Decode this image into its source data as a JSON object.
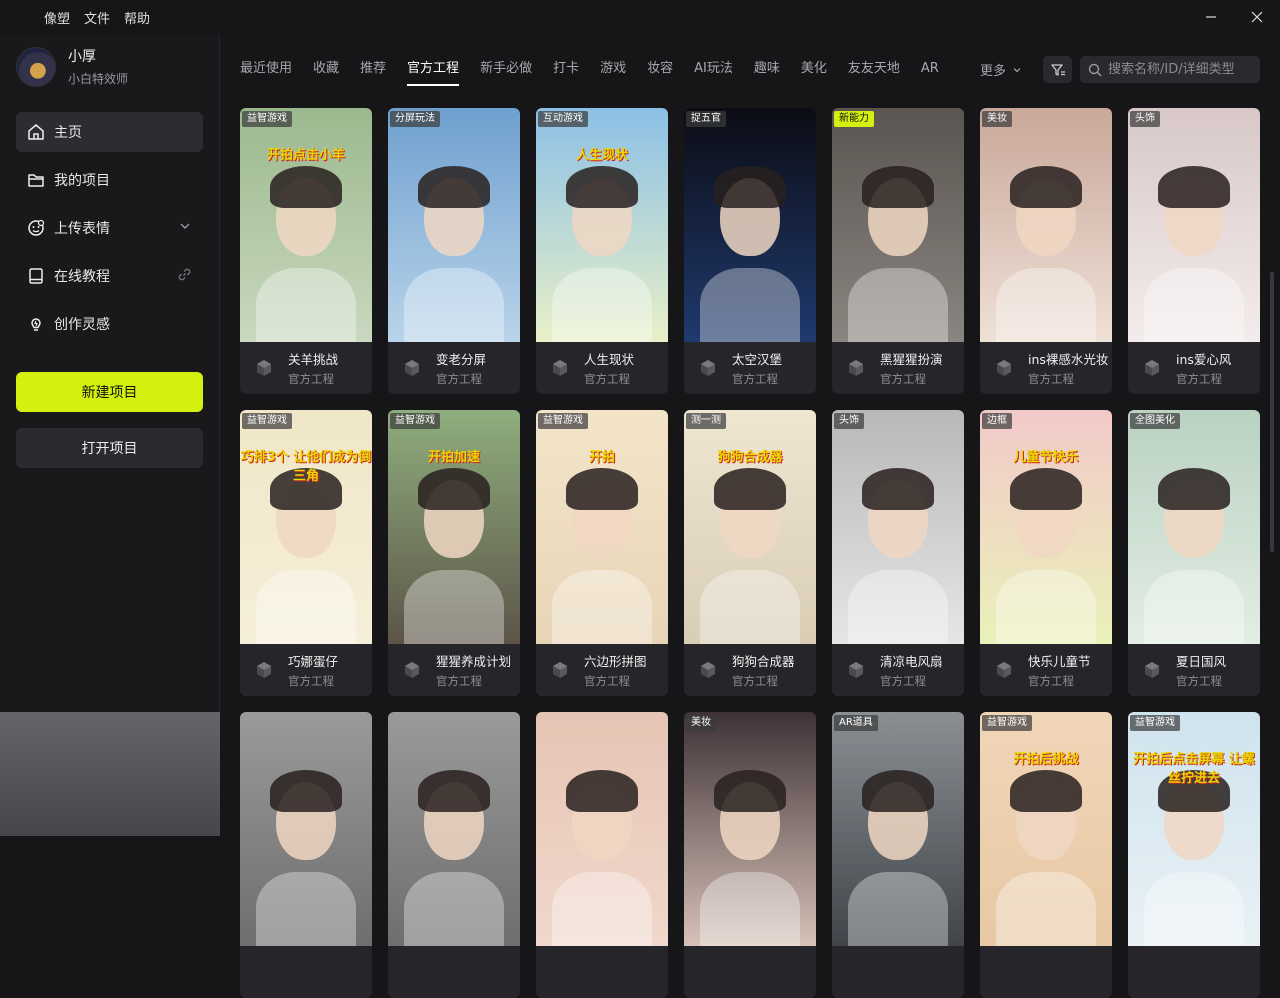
{
  "titlebar": {
    "menus": [
      "像塑",
      "文件",
      "帮助"
    ]
  },
  "user": {
    "name": "小厚",
    "role": "小白特效师"
  },
  "nav": [
    {
      "label": "主页",
      "icon": "home-icon",
      "active": true
    },
    {
      "label": "我的项目",
      "icon": "folder-icon",
      "active": false
    },
    {
      "label": "上传表情",
      "icon": "face-upload-icon",
      "active": false,
      "trail": "chevron-down-icon"
    },
    {
      "label": "在线教程",
      "icon": "book-icon",
      "active": false,
      "trail": "link-icon"
    },
    {
      "label": "创作灵感",
      "icon": "bulb-icon",
      "active": false
    }
  ],
  "buttons": {
    "new_project": "新建项目",
    "open_project": "打开项目"
  },
  "tabs": [
    "最近使用",
    "收藏",
    "推荐",
    "官方工程",
    "新手必做",
    "打卡",
    "游戏",
    "妆容",
    "AI玩法",
    "趣味",
    "美化",
    "友友天地",
    "AR"
  ],
  "active_tab": "官方工程",
  "more_label": "更多",
  "search": {
    "placeholder": "搜索名称/ID/详细类型"
  },
  "cards": [
    {
      "badge": "益智游戏",
      "title": "关羊挑战",
      "subtitle": "官方工程",
      "thumb_text": "开拍点击小羊",
      "bg": [
        "#9bb98e",
        "#c9d8bf"
      ]
    },
    {
      "badge": "分屏玩法",
      "title": "变老分屏",
      "subtitle": "官方工程",
      "thumb_text": "",
      "bg": [
        "#6fa0cf",
        "#b9d4ea"
      ]
    },
    {
      "badge": "互动游戏",
      "title": "人生现状",
      "subtitle": "官方工程",
      "thumb_text": "人生现状",
      "bg": [
        "#8cc0e6",
        "#e8f0c8"
      ]
    },
    {
      "badge": "捉五官",
      "title": "太空汉堡",
      "subtitle": "官方工程",
      "thumb_text": "",
      "bg": [
        "#0c0c14",
        "#1f3a6e"
      ]
    },
    {
      "badge": "新能力",
      "badge_yellow": true,
      "title": "黑猩猩扮演",
      "subtitle": "官方工程",
      "thumb_text": "",
      "bg": [
        "#5a5550",
        "#8a8580"
      ]
    },
    {
      "badge": "美妆",
      "title": "ins裸感水光妆",
      "subtitle": "官方工程",
      "thumb_text": "",
      "bg": [
        "#c9a89a",
        "#efe0d6"
      ]
    },
    {
      "badge": "头饰",
      "title": "ins爱心风",
      "subtitle": "官方工程",
      "thumb_text": "",
      "bg": [
        "#d8c8c8",
        "#f4ecec"
      ]
    },
    {
      "badge": "益智游戏",
      "title": "巧娜蛋仔",
      "subtitle": "官方工程",
      "thumb_text": "巧排3个 让他们成为倒三角",
      "bg": [
        "#f0e6c8",
        "#f6efd9"
      ]
    },
    {
      "badge": "益智游戏",
      "title": "猩猩养成计划",
      "subtitle": "官方工程",
      "thumb_text": "开拍加速",
      "bg": [
        "#8fae7e",
        "#5c5448"
      ]
    },
    {
      "badge": "益智游戏",
      "title": "六边形拼图",
      "subtitle": "官方工程",
      "thumb_text": "开拍",
      "bg": [
        "#f3e4c9",
        "#e8d5b8"
      ]
    },
    {
      "badge": "测一测",
      "title": "狗狗合成器",
      "subtitle": "官方工程",
      "thumb_text": "狗狗合成器",
      "bg": [
        "#efe6d2",
        "#d9cdb5"
      ]
    },
    {
      "badge": "头饰",
      "title": "清凉电风扇",
      "subtitle": "官方工程",
      "thumb_text": "",
      "bg": [
        "#b8b8b8",
        "#e6e6e6"
      ]
    },
    {
      "badge": "边框",
      "title": "快乐儿童节",
      "subtitle": "官方工程",
      "thumb_text": "儿童节快乐",
      "bg": [
        "#f2c9c9",
        "#eaf1b9"
      ]
    },
    {
      "badge": "全图美化",
      "title": "夏日国风",
      "subtitle": "官方工程",
      "thumb_text": "",
      "bg": [
        "#b9d2c2",
        "#e3ede4"
      ]
    },
    {
      "badge": "",
      "title": "",
      "subtitle": "",
      "thumb_text": "",
      "bg": [
        "#9a9a9a",
        "#6e6e6e"
      ]
    },
    {
      "badge": "",
      "title": "",
      "subtitle": "",
      "thumb_text": "",
      "bg": [
        "#9a9a9a",
        "#6e6e6e"
      ]
    },
    {
      "badge": "",
      "title": "",
      "subtitle": "",
      "thumb_text": "",
      "bg": [
        "#e6c4b4",
        "#f0d8cc"
      ]
    },
    {
      "badge": "美妆",
      "title": "",
      "subtitle": "",
      "thumb_text": "",
      "bg": [
        "#3e3236",
        "#d8c2b8"
      ]
    },
    {
      "badge": "AR道具",
      "title": "",
      "subtitle": "",
      "thumb_text": "",
      "bg": [
        "#8a8f94",
        "#40454a"
      ]
    },
    {
      "badge": "益智游戏",
      "title": "",
      "subtitle": "",
      "thumb_text": "开拍后挑战",
      "bg": [
        "#f0d6b8",
        "#e8c8a4"
      ]
    },
    {
      "badge": "益智游戏",
      "title": "",
      "subtitle": "",
      "thumb_text": "开拍后点击屏幕 让螺丝拧进去",
      "bg": [
        "#cfe3ee",
        "#e9f1f5"
      ]
    }
  ]
}
